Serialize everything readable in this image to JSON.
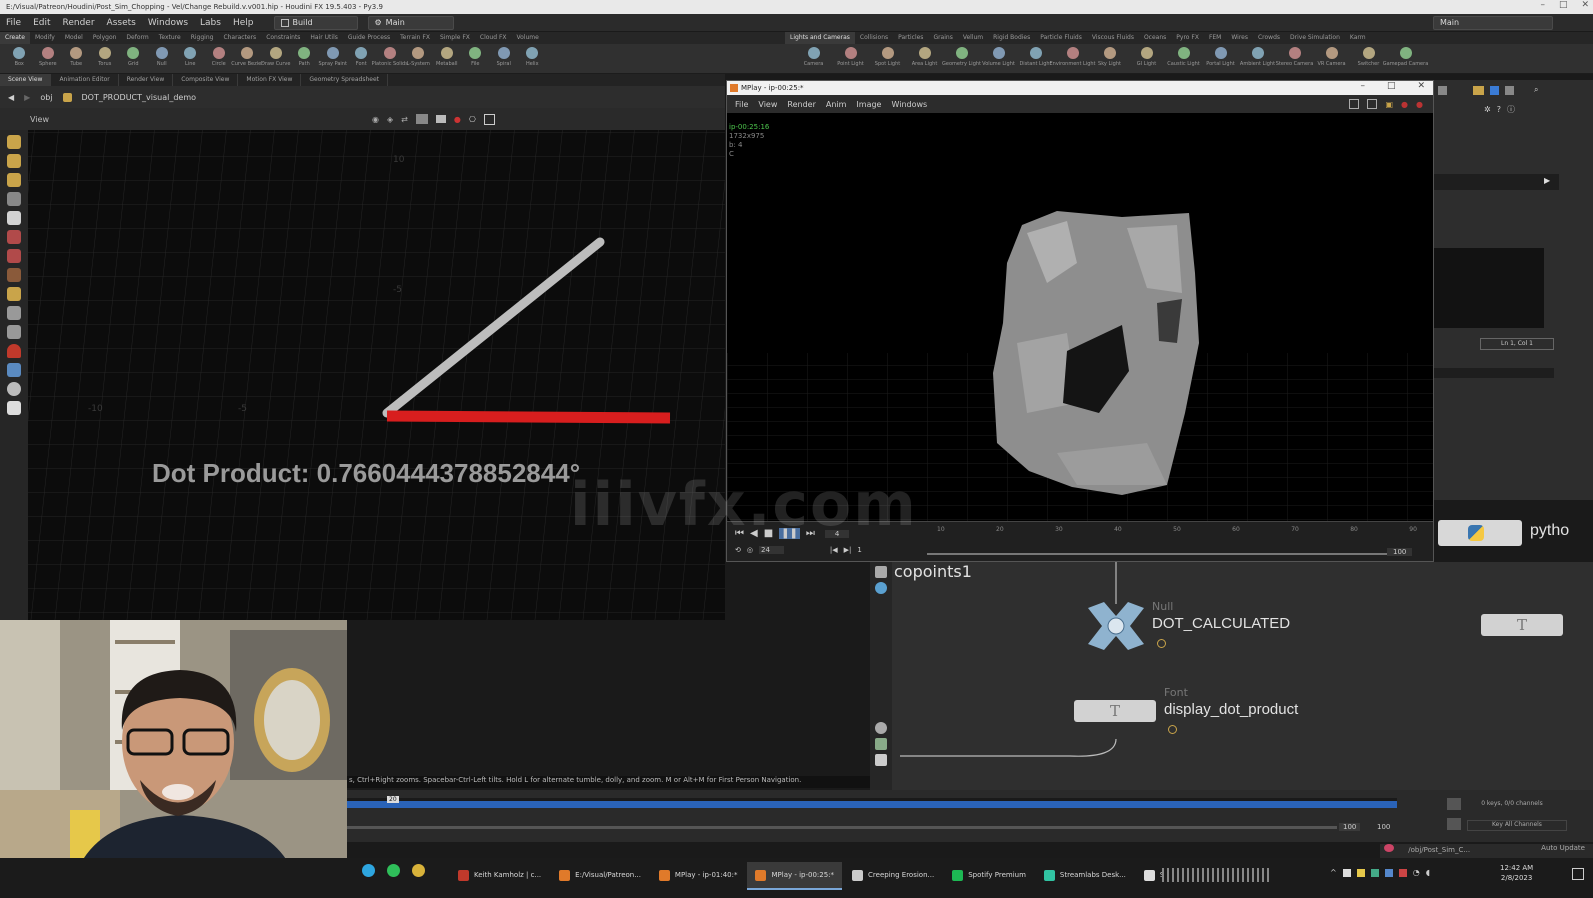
{
  "window": {
    "title": "E:/Visual/Patreon/Houdini/Post_Sim_Chopping - Vel/Change Rebuild.v.v001.hip - Houdini FX 19.5.403 - Py3.9",
    "desktop_name": "Main"
  },
  "menu": {
    "items": [
      "File",
      "Edit",
      "Render",
      "Assets",
      "Windows",
      "Labs",
      "Help"
    ],
    "desktop_left": "Build",
    "desktop_mid": "Main"
  },
  "shelf_tabs_left": [
    "Create",
    "Modify",
    "Model",
    "Polygon",
    "Deform",
    "Texture",
    "Rigging",
    "Characters",
    "Constraints",
    "Hair Utils",
    "Guide Process",
    "Terrain FX",
    "Simple FX",
    "Cloud FX",
    "Volume"
  ],
  "shelf_tabs_right": [
    "Lights and Cameras",
    "Collisions",
    "Particles",
    "Grains",
    "Vellum",
    "Rigid Bodies",
    "Particle Fluids",
    "Viscous Fluids",
    "Oceans",
    "Pyro FX",
    "FEM",
    "Wires",
    "Crowds",
    "Drive Simulation",
    "Karm"
  ],
  "shelf_tools_left": [
    "Box",
    "Sphere",
    "Tube",
    "Torus",
    "Grid",
    "Null",
    "Line",
    "Circle",
    "Curve Bezier",
    "Draw Curve",
    "Path",
    "Spray Paint",
    "Font",
    "Platonic Solids",
    "L-System",
    "Metaball",
    "File",
    "Spiral",
    "Helix"
  ],
  "shelf_tools_right": [
    "Camera",
    "Point Light",
    "Spot Light",
    "Area Light",
    "Geometry Light",
    "Volume Light",
    "Distant Light",
    "Environment Light",
    "Sky Light",
    "GI Light",
    "Caustic Light",
    "Portal Light",
    "Ambient Light",
    "Stereo Camera",
    "VR Camera",
    "Switcher",
    "Gamepad Camera"
  ],
  "pane_tabs": [
    "Scene View",
    "Animation Editor",
    "Render View",
    "Composite View",
    "Motion FX View",
    "Geometry Spreadsheet"
  ],
  "path": {
    "root": "obj",
    "node": "DOT_PRODUCT_visual_demo"
  },
  "viewport": {
    "header_label": "View",
    "dot_text": "Dot Product: 0.7660444378852844",
    "dot_degree": "°",
    "hint": "s, Ctrl+Right zooms. Spacebar-Ctrl-Left tilts. Hold L for alternate tumble, dolly, and zoom.    M or Alt+M for First Person Navigation.",
    "grid_labels": [
      "-10",
      "-5",
      "10",
      "-5",
      "10"
    ]
  },
  "mplay": {
    "title": "MPlay - ip-00:25:*",
    "menu": [
      "File",
      "View",
      "Render",
      "Anim",
      "Image",
      "Windows"
    ],
    "info": [
      "ip-00:25:16",
      "1732x975",
      "b: 4",
      "C"
    ],
    "frame": "4",
    "fps": "24",
    "start": "1",
    "end": "100",
    "ruler": [
      "10",
      "20",
      "30",
      "40",
      "50",
      "60",
      "70",
      "80",
      "90"
    ]
  },
  "watermark": "iiivfx.com",
  "network": {
    "partial_node": "copoints1",
    "python_label": "pytho",
    "null_node": {
      "type": "Null",
      "name": "DOT_CALCULATED"
    },
    "font_node": {
      "type": "Font",
      "name": "display_dot_product"
    }
  },
  "rightpane": {
    "status": "Ln 1, Col 1"
  },
  "timeline": {
    "current": "20",
    "start": "100",
    "end": "100",
    "keys_info": "0 keys, 0/0 channels",
    "key_all": "Key All Channels",
    "obj_path": "/obj/Post_Sim_C...",
    "auto_update": "Auto Update"
  },
  "taskbar": {
    "items": [
      {
        "label": "Keith Kamholz | c...",
        "color": "#c0392b"
      },
      {
        "label": "E:/Visual/Patreon...",
        "color": "#e07a2a"
      },
      {
        "label": "MPlay - ip-01:40:*",
        "color": "#e07a2a"
      },
      {
        "label": "MPlay - ip-00:25:*",
        "color": "#e07a2a"
      },
      {
        "label": "Creeping Erosion...",
        "color": "#cccccc"
      },
      {
        "label": "Spotify Premium",
        "color": "#1db954"
      },
      {
        "label": "Streamlabs Desk...",
        "color": "#31c3a2"
      },
      {
        "label": "Settings",
        "color": "#dddddd"
      }
    ],
    "clock_time": "12:42 AM",
    "clock_date": "2/8/2023"
  },
  "colors": {
    "accent": "#7aa7d8",
    "red_vector": "#d81e1e",
    "grey_vector": "#bdbdbd",
    "timeline_bar": "#2a63b8"
  }
}
